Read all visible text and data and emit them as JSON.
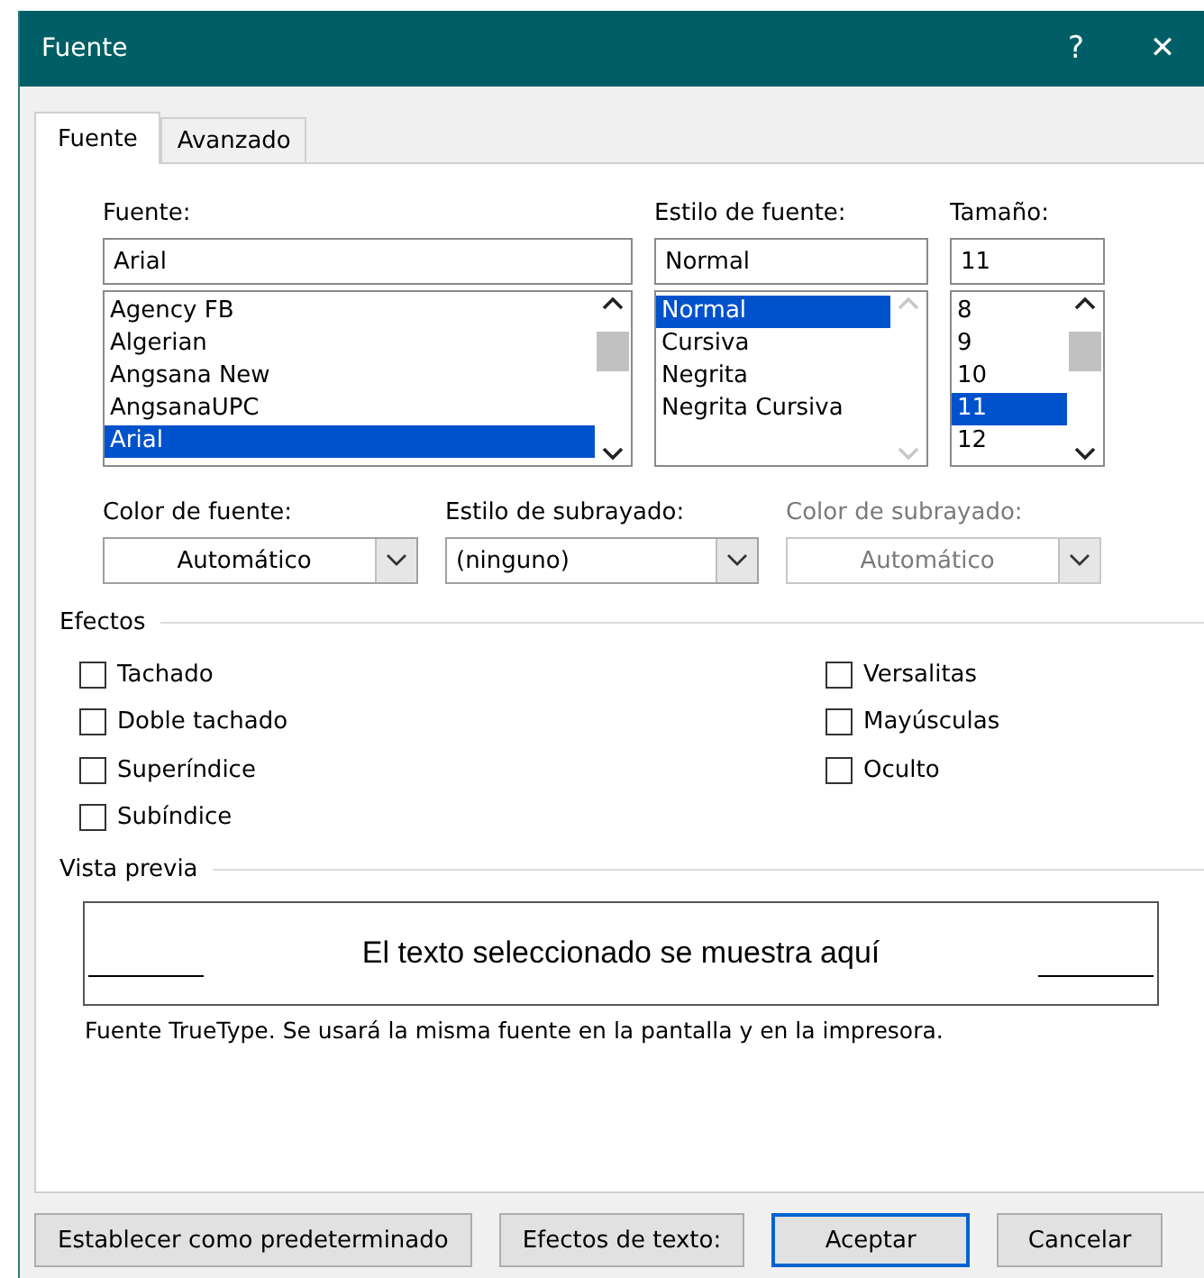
{
  "window": {
    "title": "Fuente",
    "help": "?",
    "close": "✕"
  },
  "tabs": [
    {
      "label": "Fuente",
      "selected": true
    },
    {
      "label": "Avanzado",
      "selected": false
    }
  ],
  "font": {
    "label": "Fuente:",
    "value": "Arial",
    "items": [
      {
        "label": "Agency FB",
        "selected": false
      },
      {
        "label": "Algerian",
        "selected": false
      },
      {
        "label": "Angsana New",
        "selected": false
      },
      {
        "label": "AngsanaUPC",
        "selected": false
      },
      {
        "label": "Arial",
        "selected": true
      }
    ]
  },
  "style": {
    "label": "Estilo de fuente:",
    "value": "Normal",
    "items": [
      {
        "label": "Normal",
        "selected": true
      },
      {
        "label": "Cursiva",
        "selected": false
      },
      {
        "label": "Negrita",
        "selected": false
      },
      {
        "label": "Negrita Cursiva",
        "selected": false
      }
    ]
  },
  "size": {
    "label": "Tamaño:",
    "value": "11",
    "items": [
      {
        "label": "8",
        "selected": false
      },
      {
        "label": "9",
        "selected": false
      },
      {
        "label": "10",
        "selected": false
      },
      {
        "label": "11",
        "selected": true
      },
      {
        "label": "12",
        "selected": false
      }
    ]
  },
  "dropdowns": [
    {
      "label": "Color de fuente:",
      "value": "Automático",
      "disabled": false,
      "centered": true
    },
    {
      "label": "Estilo de subrayado:",
      "value": "(ninguno)",
      "disabled": false,
      "centered": false
    },
    {
      "label": "Color de subrayado:",
      "value": "Automático",
      "disabled": true,
      "centered": true
    }
  ],
  "effects": {
    "title": "Efectos",
    "left": [
      {
        "label": "Tachado",
        "checked": false
      },
      {
        "label": "Doble tachado",
        "checked": false
      },
      {
        "label": "Superíndice",
        "checked": false
      },
      {
        "label": "Subíndice",
        "checked": false
      }
    ],
    "right": [
      {
        "label": "Versalitas",
        "checked": false
      },
      {
        "label": "Mayúsculas",
        "checked": false
      },
      {
        "label": "Oculto",
        "checked": false
      }
    ]
  },
  "preview": {
    "title": "Vista previa",
    "sample": "El texto seleccionado se muestra aquí",
    "note": "Fuente TrueType. Se usará la misma fuente en la pantalla y en la impresora."
  },
  "buttons": [
    {
      "label": "Establecer como predeterminado",
      "default": false
    },
    {
      "label": "Efectos de texto:",
      "default": false
    },
    {
      "label": "Aceptar",
      "default": true
    },
    {
      "label": "Cancelar",
      "default": false
    }
  ]
}
